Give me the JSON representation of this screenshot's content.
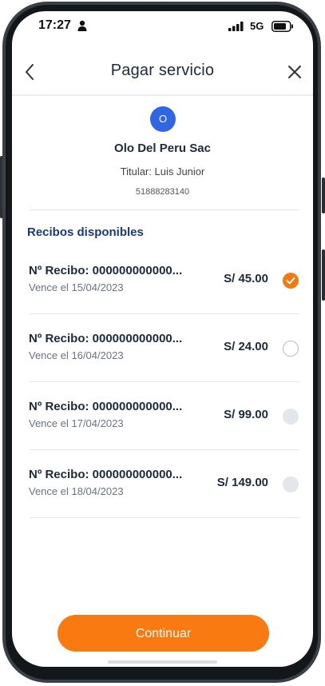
{
  "status_bar": {
    "time": "17:27",
    "network": "5G",
    "icons": [
      "person-icon",
      "signal-icon",
      "battery-icon"
    ]
  },
  "header": {
    "title": "Pagar servicio",
    "back_icon": "chevron-left-icon",
    "close_icon": "close-icon"
  },
  "company": {
    "avatar_letter": "O",
    "name": "Olo Del Peru Sac",
    "holder": "Titular: Luis Junior",
    "account_number": "51888283140"
  },
  "receipts_section": {
    "title": "Recibos disponibles",
    "items": [
      {
        "number": "Nº Recibo: 000000000000...",
        "due": "Vence el 15/04/2023",
        "amount": "S/ 45.00",
        "state": "checked"
      },
      {
        "number": "Nº Recibo: 000000000000...",
        "due": "Vence el 16/04/2023",
        "amount": "S/ 24.00",
        "state": "unchecked"
      },
      {
        "number": "Nº Recibo: 000000000000...",
        "due": "Vence el 17/04/2023",
        "amount": "S/ 99.00",
        "state": "disabled"
      },
      {
        "number": "Nº Recibo: 000000000000...",
        "due": "Vence el 18/04/2023",
        "amount": "S/ 149.00",
        "state": "disabled"
      }
    ]
  },
  "footer": {
    "continue_label": "Continuar"
  },
  "colors": {
    "accent": "#fa7a12",
    "primary_blue": "#2e66e6",
    "section_title": "#1a3a7a",
    "text_dark": "#1c2a3c"
  }
}
